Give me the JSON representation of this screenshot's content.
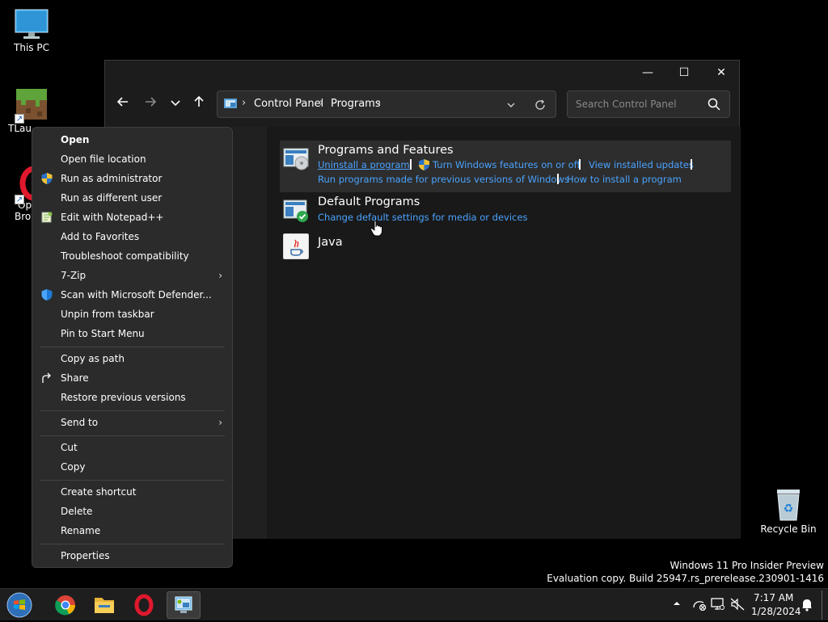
{
  "desktop": {
    "icons": [
      {
        "label": "This PC"
      },
      {
        "label": "TLau"
      },
      {
        "label": "Op"
      },
      {
        "label": "Brow"
      },
      {
        "label": "Recycle Bin"
      }
    ]
  },
  "window": {
    "controls": {
      "minimize": "—",
      "maximize": "☐",
      "close": "✕"
    },
    "breadcrumb": [
      "Control Panel",
      "Programs"
    ],
    "search_placeholder": "Search Control Panel",
    "categories": [
      {
        "title": "Programs and Features",
        "links": [
          "Uninstall a program",
          "Turn Windows features on or off",
          "View installed updates",
          "Run programs made for previous versions of Windows",
          "How to install a program"
        ]
      },
      {
        "title": "Default Programs",
        "links": [
          "Change default settings for media or devices"
        ]
      },
      {
        "title": "Java",
        "links": []
      }
    ]
  },
  "context_menu": {
    "items": [
      "Open",
      "Open file location",
      "Run as administrator",
      "Run as different user",
      "Edit with Notepad++",
      "Add to Favorites",
      "Troubleshoot compatibility",
      "7-Zip",
      "Scan with Microsoft Defender...",
      "Unpin from taskbar",
      "Pin to Start Menu",
      "Copy as path",
      "Share",
      "Restore previous versions",
      "Send to",
      "Cut",
      "Copy",
      "Create shortcut",
      "Delete",
      "Rename",
      "Properties"
    ]
  },
  "watermark": {
    "line1": "Windows 11 Pro Insider Preview",
    "line2": "Evaluation copy. Build 25947.rs_prerelease.230901-1416"
  },
  "taskbar": {
    "time": "7:17 AM",
    "date": "1/28/2024"
  },
  "colors": {
    "link": "#4aa3ff",
    "menu_bg": "#2b2b2b",
    "window_bg": "#1c1c1c"
  }
}
